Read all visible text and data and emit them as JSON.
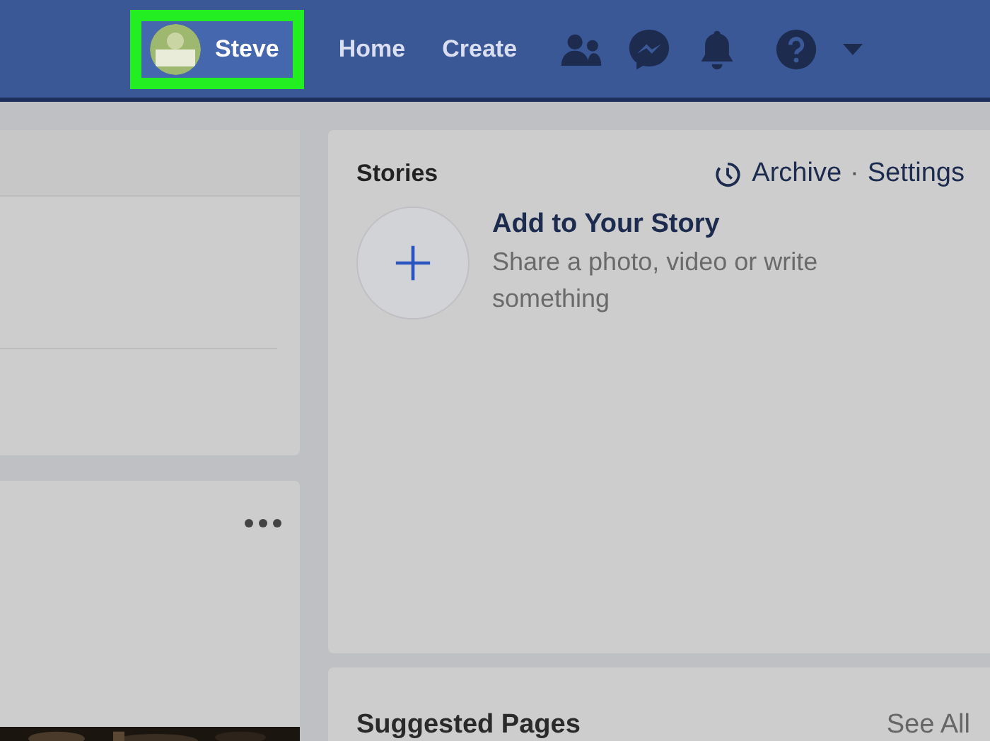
{
  "header": {
    "profile": {
      "name": "Steve",
      "highlighted": true
    },
    "nav": [
      {
        "label": "Home"
      },
      {
        "label": "Create"
      }
    ],
    "icons": [
      {
        "kind": "friends"
      },
      {
        "kind": "messenger"
      },
      {
        "kind": "bell"
      },
      {
        "kind": "help"
      },
      {
        "kind": "caret"
      }
    ]
  },
  "left_cards": [
    {
      "kind": "composer"
    },
    {
      "kind": "post"
    }
  ],
  "stories": {
    "title": "Stories",
    "archive": "Archive",
    "separator": "·",
    "settings": "Settings",
    "add_title": "Add to Your Story",
    "add_text": "Share a photo, video or write something"
  },
  "suggested": {
    "title": "Suggested Pages",
    "link": "See All"
  }
}
